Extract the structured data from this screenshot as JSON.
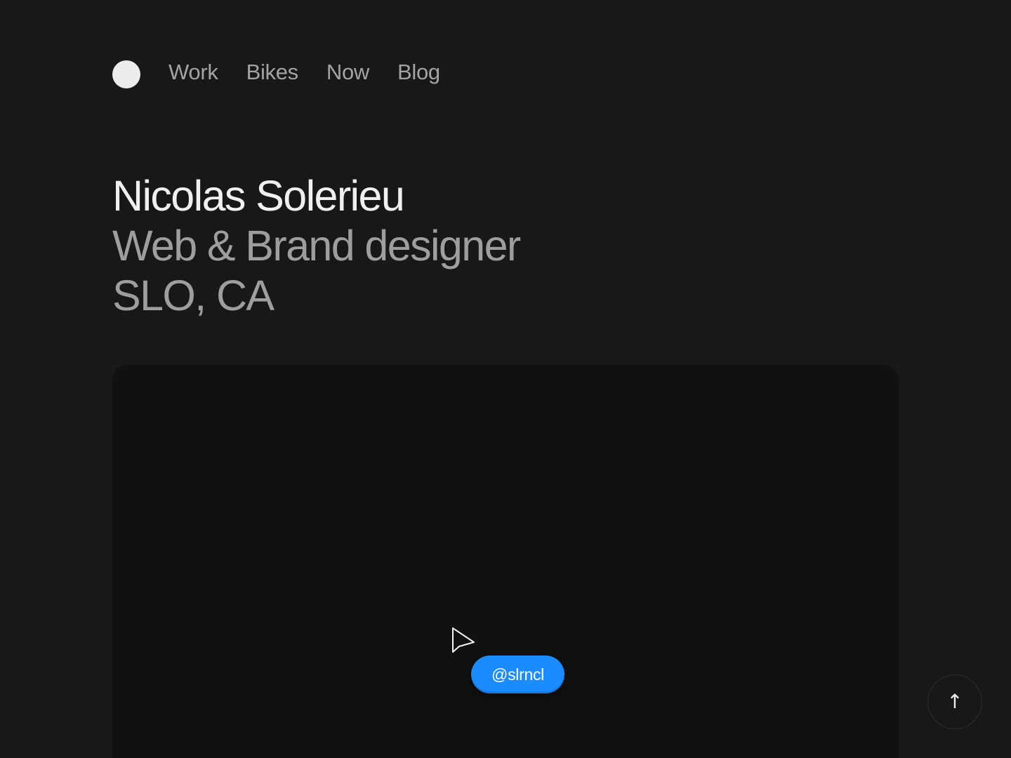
{
  "nav": {
    "items": [
      {
        "label": "Work"
      },
      {
        "label": "Bikes"
      },
      {
        "label": "Now"
      },
      {
        "label": "Blog"
      }
    ]
  },
  "hero": {
    "name": "Nicolas Solerieu",
    "role": "Web & Brand designer",
    "location": "SLO, CA"
  },
  "cursor_tag": {
    "label": "@slrncl"
  },
  "scroll_top": {
    "glyph": "↑",
    "icon": "arrow-up-icon"
  },
  "colors": {
    "background": "#181818",
    "card": "#111111",
    "accent": "#1a8cff",
    "heading": "#f0f0f0",
    "muted": "#9e9e9e"
  }
}
